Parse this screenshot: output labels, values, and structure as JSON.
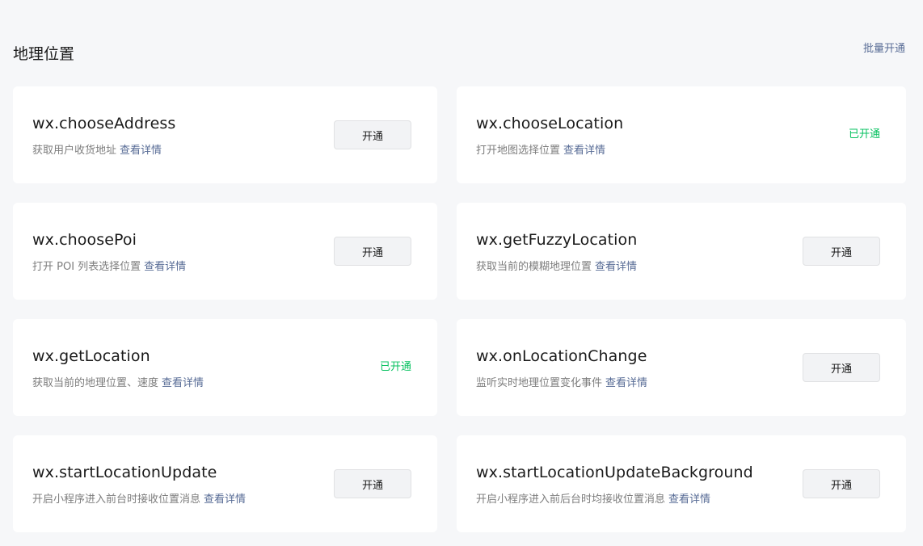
{
  "section": {
    "title": "地理位置",
    "batch_open_label": "批量开通"
  },
  "apis": [
    {
      "name": "wx.chooseAddress",
      "desc": "获取用户收货地址",
      "detail": "查看详情",
      "status": "button",
      "action_label": "开通"
    },
    {
      "name": "wx.chooseLocation",
      "desc": "打开地图选择位置",
      "detail": "查看详情",
      "status": "opened",
      "action_label": "已开通"
    },
    {
      "name": "wx.choosePoi",
      "desc": "打开 POI 列表选择位置",
      "detail": "查看详情",
      "status": "button",
      "action_label": "开通"
    },
    {
      "name": "wx.getFuzzyLocation",
      "desc": "获取当前的模糊地理位置",
      "detail": "查看详情",
      "status": "button",
      "action_label": "开通"
    },
    {
      "name": "wx.getLocation",
      "desc": "获取当前的地理位置、速度",
      "detail": "查看详情",
      "status": "opened",
      "action_label": "已开通"
    },
    {
      "name": "wx.onLocationChange",
      "desc": "监听实时地理位置变化事件",
      "detail": "查看详情",
      "status": "button",
      "action_label": "开通"
    },
    {
      "name": "wx.startLocationUpdate",
      "desc": "开启小程序进入前台时接收位置消息",
      "detail": "查看详情",
      "status": "button",
      "action_label": "开通"
    },
    {
      "name": "wx.startLocationUpdateBackground",
      "desc": "开启小程序进入前后台时均接收位置消息",
      "detail": "查看详情",
      "status": "button",
      "action_label": "开通"
    }
  ],
  "colors": {
    "link": "#576b95",
    "opened": "#07c160",
    "background": "#f6f7f9",
    "card": "#ffffff"
  }
}
